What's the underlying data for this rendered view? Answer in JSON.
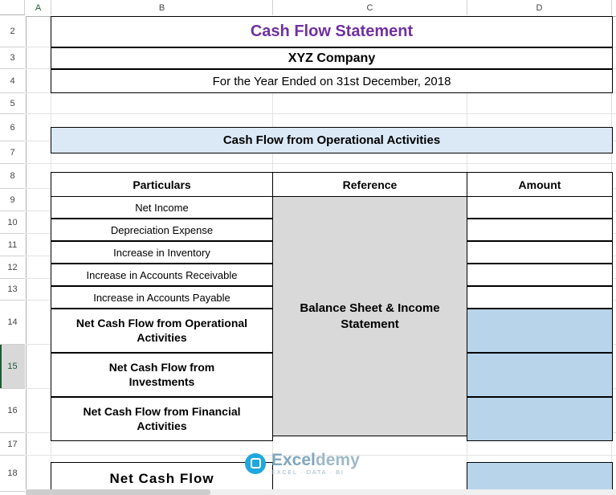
{
  "app": {
    "type": "spreadsheet",
    "column_headers": [
      "A",
      "B",
      "C",
      "D"
    ],
    "row_headers": [
      "2",
      "3",
      "4",
      "5",
      "6",
      "7",
      "8",
      "9",
      "10",
      "11",
      "12",
      "13",
      "14",
      "15",
      "16",
      "17",
      "18"
    ],
    "selected_row": "15",
    "selected_column": "A"
  },
  "sheet": {
    "title": "Cash Flow Statement",
    "company": "XYZ Company",
    "subtitle": "For the Year Ended on 31st December, 2018",
    "section_header": "Cash Flow from Operational Activities",
    "table_headers": {
      "particulars": "Particulars",
      "reference": "Reference",
      "amount": "Amount"
    },
    "reference_merged_text": "Balance Sheet & Income Statement",
    "rows": [
      {
        "particular": "Net Income",
        "amount": ""
      },
      {
        "particular": "Depreciation Expense",
        "amount": ""
      },
      {
        "particular": "Increase in Inventory",
        "amount": ""
      },
      {
        "particular": "Increase in Accounts Receivable",
        "amount": ""
      },
      {
        "particular": "Increase in Accounts Payable",
        "amount": ""
      },
      {
        "particular": "Net Cash Flow from Operational Activities",
        "amount": ""
      },
      {
        "particular": "Net Cash Flow from Investments",
        "amount": ""
      },
      {
        "particular": "Net Cash Flow from Financial Activities",
        "amount": ""
      }
    ],
    "net_cash_flow_label": "Net Cash Flow",
    "net_cash_flow_amount": ""
  },
  "watermark": {
    "main_prefix": "Excel",
    "main_suffix": "demy",
    "sub": "EXCEL · DATA · BI"
  },
  "colors": {
    "title": "#7030a0",
    "section_fill": "#dbe9f6",
    "reference_fill": "#d9d9d9",
    "amount_fill": "#b8d4ea",
    "grid": "#e2e2e2"
  }
}
